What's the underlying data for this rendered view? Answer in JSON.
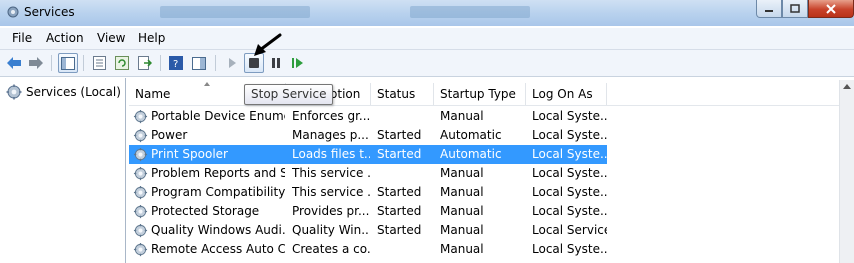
{
  "window": {
    "title": "Services"
  },
  "menu": [
    "File",
    "Action",
    "View",
    "Help"
  ],
  "toolbar": {
    "icons": [
      "back-icon",
      "forward-icon",
      "show-hide-console-tree-icon",
      "properties-icon",
      "refresh-icon",
      "export-list-icon",
      "help-icon",
      "show-action-pane-icon",
      "start-service-icon",
      "stop-service-icon",
      "pause-service-icon",
      "resume-service-icon"
    ]
  },
  "tree": {
    "label": "Services (Local)"
  },
  "tooltip": {
    "text": "Stop Service"
  },
  "columns": {
    "name": "Name",
    "description": "Description",
    "status": "Status",
    "startup": "Startup Type",
    "logon": "Log On As"
  },
  "rows": [
    {
      "name": "Portable Device Enume...",
      "description": "Enforces gr...",
      "status": "",
      "startup": "Manual",
      "logon": "Local Syste..."
    },
    {
      "name": "Power",
      "description": "Manages p...",
      "status": "Started",
      "startup": "Automatic",
      "logon": "Local Syste..."
    },
    {
      "name": "Print Spooler",
      "description": "Loads files t...",
      "status": "Started",
      "startup": "Automatic",
      "logon": "Local Syste..."
    },
    {
      "name": "Problem Reports and S...",
      "description": "This service ...",
      "status": "",
      "startup": "Manual",
      "logon": "Local Syste..."
    },
    {
      "name": "Program Compatibility ...",
      "description": "This service ...",
      "status": "Started",
      "startup": "Manual",
      "logon": "Local Syste..."
    },
    {
      "name": "Protected Storage",
      "description": "Provides pr...",
      "status": "Started",
      "startup": "Manual",
      "logon": "Local Syste..."
    },
    {
      "name": "Quality Windows Audi...",
      "description": "Quality Win...",
      "status": "Started",
      "startup": "Manual",
      "logon": "Local Service"
    },
    {
      "name": "Remote Access Auto C...",
      "description": "Creates a co...",
      "status": "",
      "startup": "Manual",
      "logon": "Local Syste..."
    }
  ],
  "selected_row": "Print Spooler",
  "colors": {
    "selection": "#3399ff",
    "titlebar": "#b9d2ee",
    "close_button": "#c8432b"
  }
}
